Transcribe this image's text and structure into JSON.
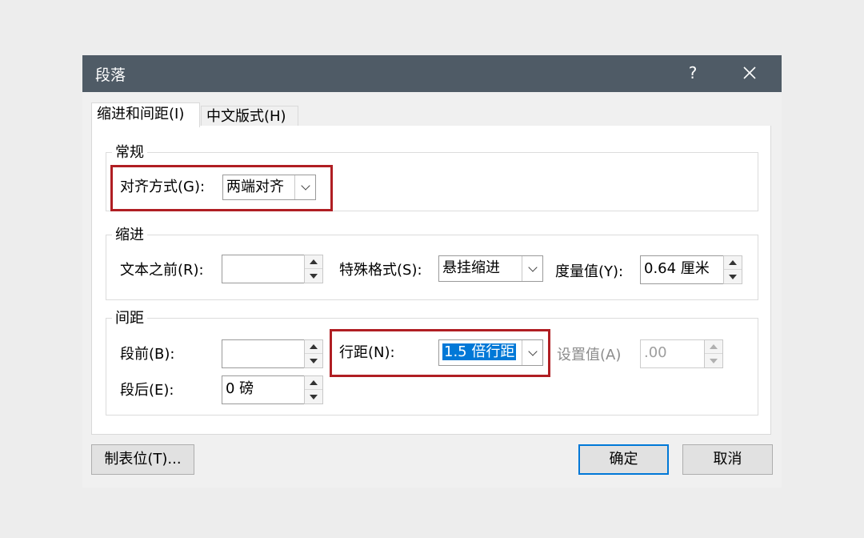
{
  "window": {
    "title": "段落",
    "help_label": "?"
  },
  "tabs": [
    {
      "label": "缩进和间距(I)"
    },
    {
      "label": "中文版式(H)"
    }
  ],
  "general": {
    "group_label": "常规",
    "alignment_label": "对齐方式(G):",
    "alignment_value": "两端对齐"
  },
  "indent": {
    "group_label": "缩进",
    "before_text_label": "文本之前(R):",
    "before_text_value": "",
    "special_label": "特殊格式(S):",
    "special_value": "悬挂缩进",
    "measure_label": "度量值(Y):",
    "measure_value": "0.64 厘米"
  },
  "spacing": {
    "group_label": "间距",
    "before_label": "段前(B):",
    "before_value": "",
    "after_label": "段后(E):",
    "after_value": "0 磅",
    "line_spacing_label": "行距(N):",
    "line_spacing_value": "1.5 倍行距",
    "set_value_label": "设置值(A)",
    "set_value_value": ".00"
  },
  "footer": {
    "tabs_button": "制表位(T)...",
    "ok_button": "确定",
    "cancel_button": "取消"
  },
  "colors": {
    "titlebar": "#4f5b66",
    "highlight": "#b01e23",
    "selection": "#0078d7"
  }
}
